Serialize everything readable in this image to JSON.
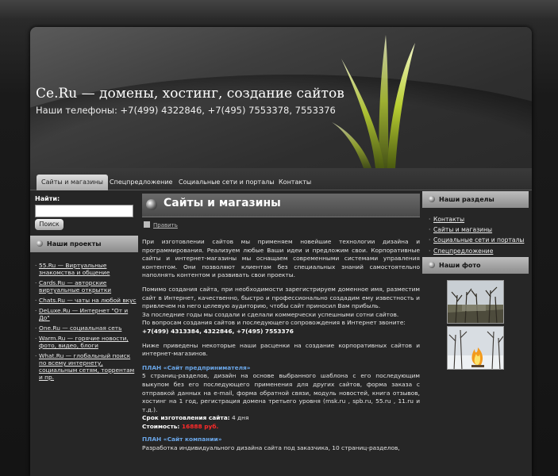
{
  "header": {
    "title": "Ce.Ru — домены, хостинг, создание сайтов",
    "phones": "Наши телефоны: +7(499) 4322846, +7(495) 7553378, 7553376"
  },
  "nav": {
    "items": [
      "Сайты и магазины",
      "Спецпредложение",
      "Социальные сети и порталы",
      "Контакты"
    ]
  },
  "search": {
    "label": "Найти:",
    "value": "",
    "button": "Поиск"
  },
  "projects": {
    "title": "Наши проекты",
    "items": [
      {
        "link": "55.Ru",
        "desc": " — Виртуальные знакомства и общение"
      },
      {
        "link": "Cards.Ru",
        "desc": " — авторские виртуальные открытки"
      },
      {
        "link": "Chats.Ru",
        "desc": " — чаты на любой вкус"
      },
      {
        "link": "DeLuxe.Ru",
        "desc": " — Интернет \"От и До\""
      },
      {
        "link": "One.Ru",
        "desc": " — социальная сеть"
      },
      {
        "link": "Warm.Ru",
        "desc": " — горячие новости, фото, видео, блоги"
      },
      {
        "link": "What.Ru",
        "desc": " — глобальный поиск по всему интернету, социальным сетям, торрентам и пр."
      }
    ]
  },
  "main": {
    "title": "Сайты и магазины",
    "edit": "Править",
    "p1": "При изготовлении сайтов мы применяем новейшие технологии дизайна и программирования. Реализуем любые Ваши идеи и предложим свои. Корпоративные сайты и интернет-магазины мы оснащаем современными системами управления контентом. Они позволяют клиентам без специальных знаний самостоятельно наполнять контентом и развивать свои проекты.",
    "p2": "Помимо создания сайта, при необходимости зарегистрируем доменное имя, разместим сайт в Интернет, качественно, быстро и профессионально создадим ему известность и привлечем на него целевую аудиторию, чтобы сайт приносил Вам прибыль.",
    "p2b": "За последние годы мы создали и сделали коммерчески успешными сотни сайтов.",
    "p2c": "По вопросам создания сайтов и последующего сопровождения в Интернет звоните:",
    "p2phones": "+7(499) 4313384, 4322846, +7(495) 7553376",
    "p3": "Ниже приведены некоторые наши расценки на создание корпоративных сайтов и интернет-магазинов.",
    "plan1_title": "ПЛАН «Сайт предпринимателя»",
    "plan1_desc": "5 страниц-разделов, дизайн на основе выбранного шаблона с его последующим выкупом без его последующего применения для других сайтов, форма заказа с отправкой данных на e-mail, форма обратной связи, модуль новостей, книга отзывов, хостинг на 1 год, регистрация домена третьего уровня (msk.ru , spb.ru, 55.ru , 11.ru и т.д.).",
    "plan1_term_label": "Срок изготовления сайта:",
    "plan1_term": " 4 дня",
    "plan1_price_label": "Стоимость:",
    "plan1_price": " 16888 руб.",
    "plan2_title": "ПЛАН «Сайт компании»",
    "plan2_desc": "Разработка индивидуального дизайна сайта под заказчика, 10 страниц-разделов,"
  },
  "sections": {
    "title": "Наши разделы",
    "items": [
      "Контакты",
      "Сайты и магазины",
      "Социальные сети и порталы",
      "Спецпредложение"
    ]
  },
  "photos": {
    "title": "Наши фото"
  },
  "colors": {
    "plan": "#6aa6e8",
    "price": "#ff2a2a",
    "grass": "#b5c934"
  }
}
